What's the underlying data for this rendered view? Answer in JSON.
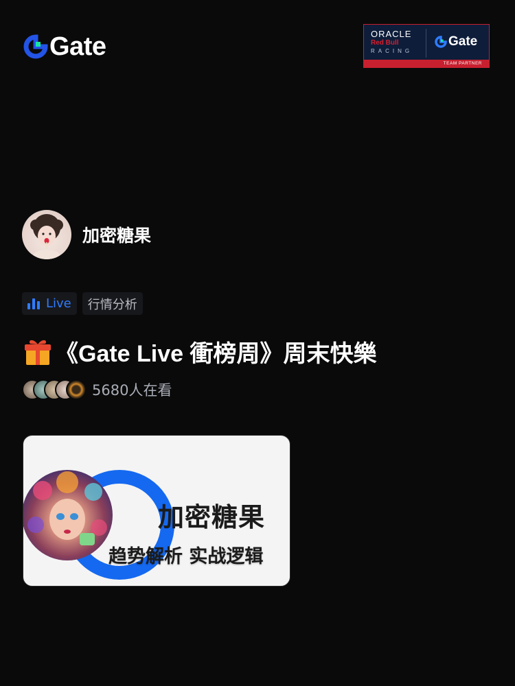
{
  "header": {
    "brand_name": "Gate",
    "partner": {
      "line1": "ORACLE",
      "line2": "Red Bull",
      "line3": "RACING",
      "brand": "Gate",
      "badge": "TEAM PARTNER"
    }
  },
  "host": {
    "name": "加密糖果"
  },
  "tags": {
    "live_label": "Live",
    "category": "行情分析"
  },
  "stream": {
    "title": "《Gate Live 衝榜周》周末快樂",
    "viewers_text": "5680人在看"
  },
  "cover": {
    "title": "加密糖果",
    "subtitle": "趋势解析 实战逻辑"
  },
  "colors": {
    "background": "#0a0a0a",
    "accent_blue": "#2f7cff",
    "gate_green": "#17e6a1",
    "partner_red": "#c8202f"
  },
  "icons": [
    "gate-logo-icon",
    "live-bars-icon",
    "gift-icon"
  ]
}
